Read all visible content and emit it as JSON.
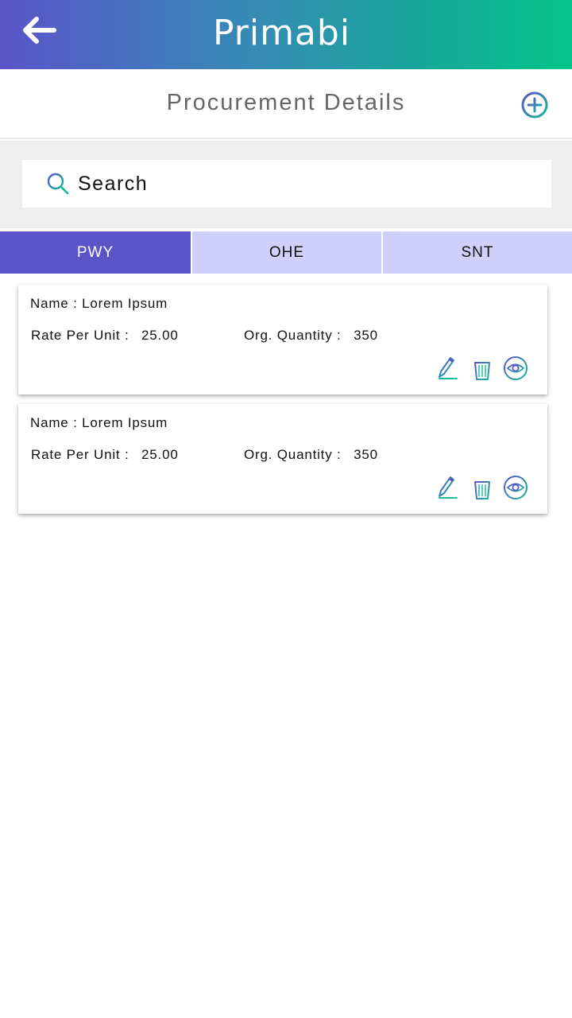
{
  "header": {
    "back_icon": "arrow-left-icon",
    "logo_text": "Primabi",
    "gradient": [
      "#5a54c9",
      "#04c48a"
    ]
  },
  "title_bar": {
    "title": "Procurement Details",
    "add_icon": "plus-circle-icon"
  },
  "search": {
    "placeholder": "Search",
    "icon": "search-icon"
  },
  "tabs": [
    {
      "label": "PWY",
      "active": true
    },
    {
      "label": "OHE",
      "active": false
    },
    {
      "label": "SNT",
      "active": false
    }
  ],
  "colors": {
    "accent": "#5a54c9",
    "tab_inactive": "#d0d0fb",
    "teal": "#14b89a"
  },
  "items": [
    {
      "name_label": "Name :",
      "name": "Lorem Ipsum",
      "rate_label": "Rate Per Unit :",
      "rate": "25.00",
      "qty_label": "Org. Quantity :",
      "qty": "350",
      "actions": [
        "pencil-icon",
        "trash-icon",
        "eye-icon"
      ]
    },
    {
      "name_label": "Name :",
      "name": "Lorem Ipsum",
      "rate_label": "Rate Per Unit :",
      "rate": "25.00",
      "qty_label": "Org. Quantity :",
      "qty": "350",
      "actions": [
        "pencil-icon",
        "trash-icon",
        "eye-icon"
      ]
    }
  ]
}
